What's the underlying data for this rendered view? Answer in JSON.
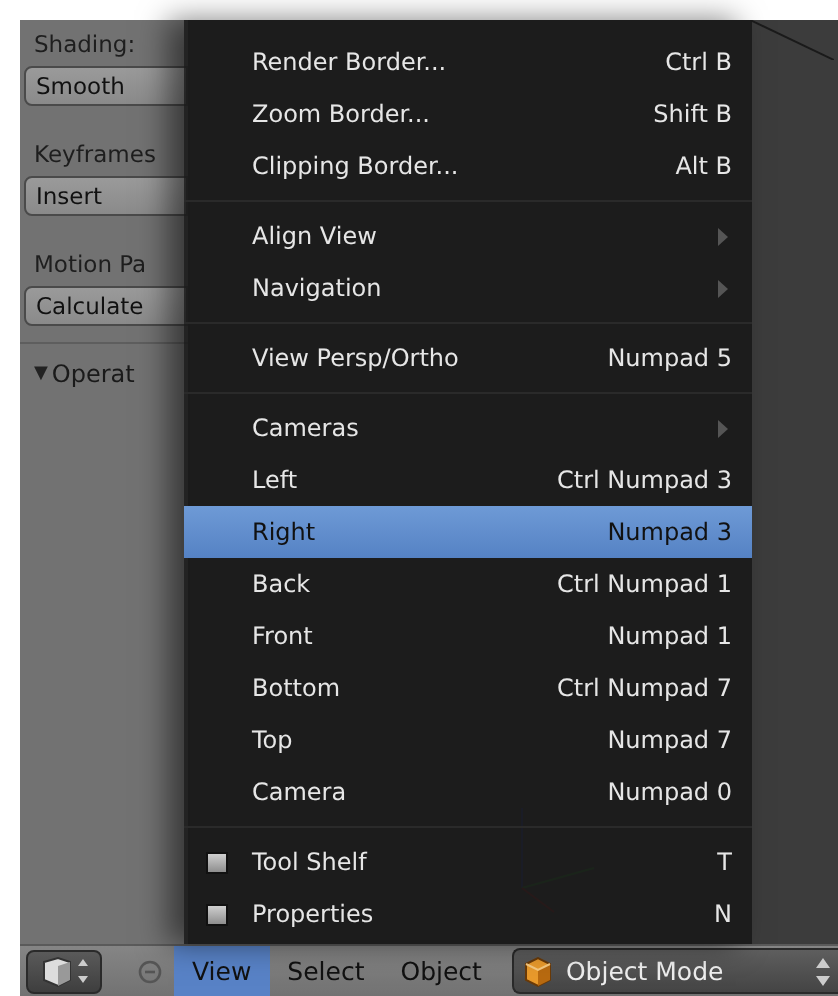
{
  "tool_shelf": {
    "groups": [
      {
        "label": "Shading:",
        "button": "Smooth"
      },
      {
        "label": "Keyframes",
        "button": "Insert"
      },
      {
        "label": "Motion Pa",
        "button": "Calculate"
      }
    ],
    "panel": {
      "arrow": "▼",
      "title": "Operat",
      "expanded": true
    }
  },
  "menu": {
    "sections": [
      [
        {
          "kind": "item",
          "label": "Render Border...",
          "shortcut": "Ctrl B",
          "selected": false
        },
        {
          "kind": "item",
          "label": "Zoom Border...",
          "shortcut": "Shift B",
          "selected": false
        },
        {
          "kind": "item",
          "label": "Clipping Border...",
          "shortcut": "Alt B",
          "selected": false
        }
      ],
      [
        {
          "kind": "submenu",
          "label": "Align View",
          "selected": false
        },
        {
          "kind": "submenu",
          "label": "Navigation",
          "selected": false
        }
      ],
      [
        {
          "kind": "item",
          "label": "View Persp/Ortho",
          "shortcut": "Numpad 5",
          "selected": false
        }
      ],
      [
        {
          "kind": "submenu",
          "label": "Cameras",
          "selected": false
        },
        {
          "kind": "item",
          "label": "Left",
          "shortcut": "Ctrl Numpad 3",
          "selected": false
        },
        {
          "kind": "item",
          "label": "Right",
          "shortcut": "Numpad 3",
          "selected": true
        },
        {
          "kind": "item",
          "label": "Back",
          "shortcut": "Ctrl Numpad 1",
          "selected": false
        },
        {
          "kind": "item",
          "label": "Front",
          "shortcut": "Numpad 1",
          "selected": false
        },
        {
          "kind": "item",
          "label": "Bottom",
          "shortcut": "Ctrl Numpad 7",
          "selected": false
        },
        {
          "kind": "item",
          "label": "Top",
          "shortcut": "Numpad 7",
          "selected": false
        },
        {
          "kind": "item",
          "label": "Camera",
          "shortcut": "Numpad 0",
          "selected": false
        }
      ],
      [
        {
          "kind": "toggle",
          "label": "Tool Shelf",
          "shortcut": "T",
          "checked": false,
          "selected": false
        },
        {
          "kind": "toggle",
          "label": "Properties",
          "shortcut": "N",
          "checked": false,
          "selected": false
        }
      ]
    ]
  },
  "header": {
    "menus": [
      {
        "label": "View",
        "selected": true
      },
      {
        "label": "Select",
        "selected": false
      },
      {
        "label": "Object",
        "selected": false
      }
    ],
    "mode": "Object Mode"
  }
}
